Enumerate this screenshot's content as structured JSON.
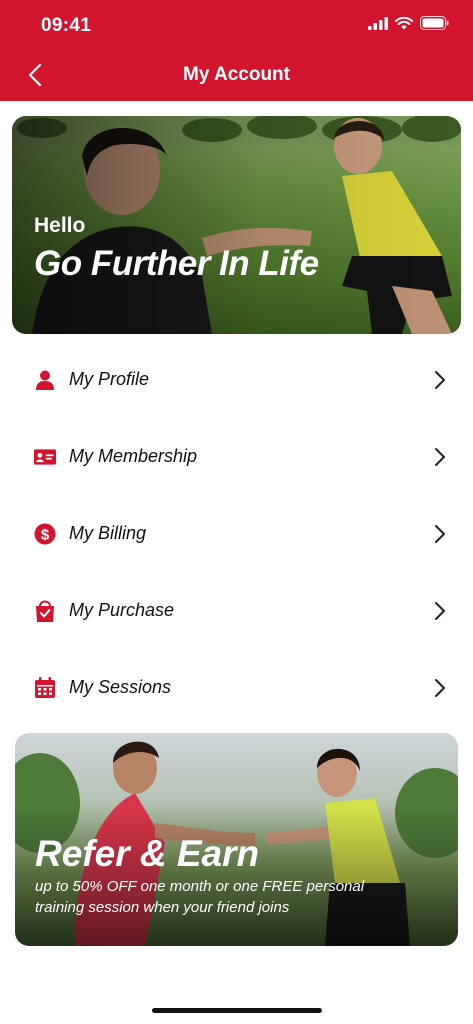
{
  "status_bar": {
    "time": "09:41"
  },
  "header": {
    "title": "My Account"
  },
  "hero": {
    "greeting": "Hello",
    "tagline": "Go Further In Life"
  },
  "menu": [
    {
      "label": "My Profile",
      "icon": "person-icon"
    },
    {
      "label": "My Membership",
      "icon": "id-card-icon"
    },
    {
      "label": "My Billing",
      "icon": "dollar-icon"
    },
    {
      "label": "My Purchase",
      "icon": "shopping-bag-icon"
    },
    {
      "label": "My Sessions",
      "icon": "calendar-icon"
    }
  ],
  "promo": {
    "title": "Refer & Earn",
    "subtitle": "up to 50% OFF one month or one FREE personal training session when your friend joins"
  },
  "colors": {
    "brand": "#d2142f",
    "background": "#ffffff",
    "text": "#111111"
  }
}
